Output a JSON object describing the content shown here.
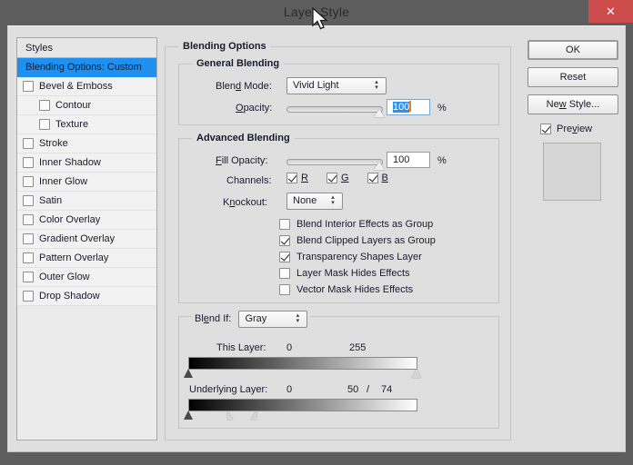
{
  "window": {
    "title": "Layer Style",
    "close_label": "✕"
  },
  "styles_panel": {
    "header": "Styles",
    "items": [
      {
        "label": "Blending Options: Custom",
        "selected": true,
        "checkbox": false,
        "checked": false,
        "indent": false
      },
      {
        "label": "Bevel & Emboss",
        "selected": false,
        "checkbox": true,
        "checked": false,
        "indent": false
      },
      {
        "label": "Contour",
        "selected": false,
        "checkbox": true,
        "checked": false,
        "indent": true
      },
      {
        "label": "Texture",
        "selected": false,
        "checkbox": true,
        "checked": false,
        "indent": true
      },
      {
        "label": "Stroke",
        "selected": false,
        "checkbox": true,
        "checked": false,
        "indent": false
      },
      {
        "label": "Inner Shadow",
        "selected": false,
        "checkbox": true,
        "checked": false,
        "indent": false
      },
      {
        "label": "Inner Glow",
        "selected": false,
        "checkbox": true,
        "checked": false,
        "indent": false
      },
      {
        "label": "Satin",
        "selected": false,
        "checkbox": true,
        "checked": false,
        "indent": false
      },
      {
        "label": "Color Overlay",
        "selected": false,
        "checkbox": true,
        "checked": false,
        "indent": false
      },
      {
        "label": "Gradient Overlay",
        "selected": false,
        "checkbox": true,
        "checked": false,
        "indent": false
      },
      {
        "label": "Pattern Overlay",
        "selected": false,
        "checkbox": true,
        "checked": false,
        "indent": false
      },
      {
        "label": "Outer Glow",
        "selected": false,
        "checkbox": true,
        "checked": false,
        "indent": false
      },
      {
        "label": "Drop Shadow",
        "selected": false,
        "checkbox": true,
        "checked": false,
        "indent": false
      }
    ]
  },
  "blending_options": {
    "legend": "Blending Options",
    "general_blending": {
      "legend": "General Blending",
      "blend_mode_label": "Blend Mode:",
      "blend_mode_value": "Vivid Light",
      "opacity_label": "Opacity:",
      "opacity_value": "100",
      "opacity_unit": "%",
      "opacity_slider_percent": 100
    },
    "advanced_blending": {
      "legend": "Advanced Blending",
      "fill_opacity_label": "Fill Opacity:",
      "fill_opacity_value": "100",
      "fill_opacity_unit": "%",
      "fill_opacity_slider_percent": 100,
      "channels_label": "Channels:",
      "channels": [
        {
          "label": "R",
          "checked": true
        },
        {
          "label": "G",
          "checked": true
        },
        {
          "label": "B",
          "checked": true
        }
      ],
      "knockout_label": "Knockout:",
      "knockout_value": "None",
      "options": [
        {
          "label": "Blend Interior Effects as Group",
          "checked": false
        },
        {
          "label": "Blend Clipped Layers as Group",
          "checked": true
        },
        {
          "label": "Transparency Shapes Layer",
          "checked": true
        },
        {
          "label": "Layer Mask Hides Effects",
          "checked": false
        },
        {
          "label": "Vector Mask Hides Effects",
          "checked": false
        }
      ]
    },
    "blend_if": {
      "legend_label": "Blend If:",
      "channel_value": "Gray",
      "this_layer": {
        "label": "This Layer:",
        "low": "0",
        "high": "255",
        "low_percent": 0,
        "high_percent": 100
      },
      "underlying_layer": {
        "label": "Underlying Layer:",
        "low": "0",
        "high_left": "50",
        "separator": "/",
        "high_right": "74",
        "low_percent": 0,
        "high_left_percent": 19,
        "high_right_percent": 29
      }
    }
  },
  "actions": {
    "ok": "OK",
    "reset": "Reset",
    "new_style": "New Style...",
    "preview_label": "Preview",
    "preview_checked": true
  },
  "colors": {
    "accent_selection": "#1e90f0",
    "close_red": "#cc4b4b",
    "chrome": "#5d5d5d",
    "dialog_bg": "#dfdfdf"
  }
}
